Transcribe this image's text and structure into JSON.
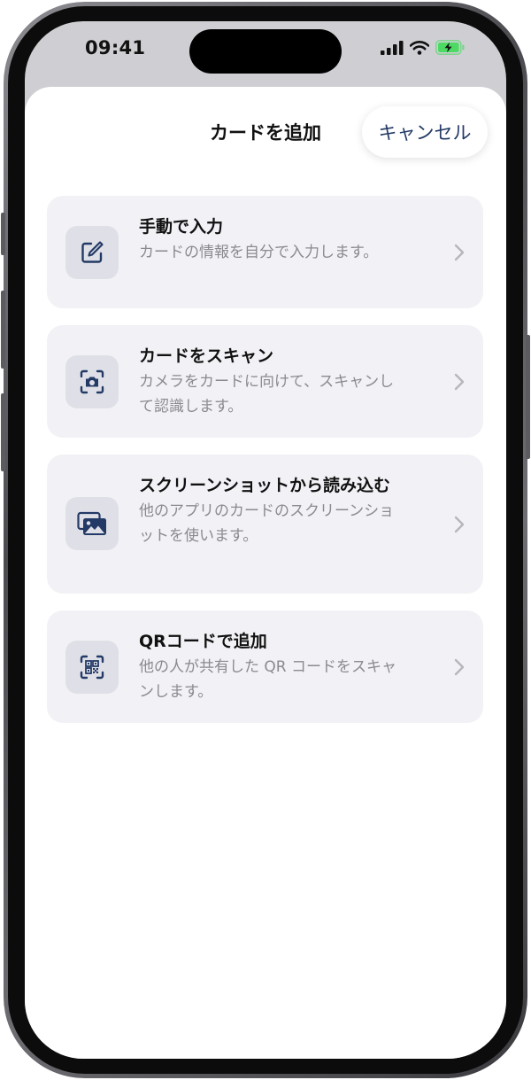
{
  "status_bar": {
    "time": "09:41",
    "icons": [
      "signal-icon",
      "wifi-icon",
      "battery-charging-icon"
    ]
  },
  "sheet": {
    "title": "カードを追加",
    "cancel_label": "キャンセル"
  },
  "options": [
    {
      "title": "手動で入力",
      "description": "カードの情報を自分で入力します。",
      "icon": "edit-icon"
    },
    {
      "title": "カードをスキャン",
      "description": "カメラをカードに向けて、スキャンして認識します。",
      "icon": "camera-scan-icon"
    },
    {
      "title": "スクリーンショットから読み込む",
      "description": "他のアプリのカードのスクリーンショットを使います。",
      "icon": "photos-icon"
    },
    {
      "title": "QRコードで追加",
      "description": "他の人が共有した QR コードをスキャンします。",
      "icon": "qr-scan-icon"
    }
  ],
  "colors": {
    "accent": "#243a66",
    "card_background": "#f2f2f6",
    "icon_background": "#dfe0e7",
    "secondary_text": "#8a8a8f",
    "battery_charging": "#4cd964"
  }
}
